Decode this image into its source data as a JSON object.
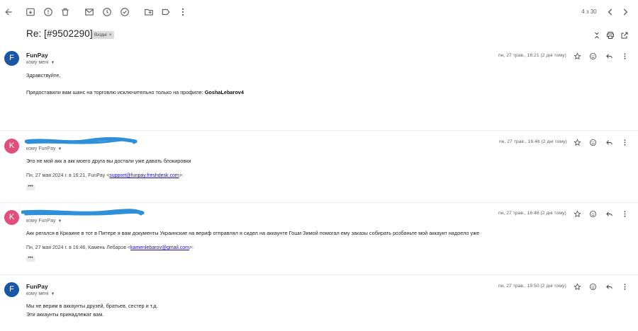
{
  "toolbar": {
    "pager": "4 з 30"
  },
  "thread": {
    "subject": "Re: [#9502290]",
    "label": "Вхідні",
    "label_close": "×"
  },
  "messages": [
    {
      "avatar_letter": "F",
      "avatar_color": "#1a56a6",
      "sender": "FunPay",
      "recipient": "кому мені",
      "date": "пн, 27 трав., 16:21 (2 дні тому)",
      "body": [
        "Здравствуйте,"
      ],
      "body_prefix": "Предоставили вам шанс на торговлю исключительно только на профиле: ",
      "body_bold": "GoshaLebarov4"
    },
    {
      "avatar_letter": "K",
      "avatar_color": "#e0507a",
      "recipient": "кому FunPay",
      "date": "пн, 27 трав., 16:46 (2 дні тому)",
      "body": [
        "Это не мой акк а акк моего друга вы достали уже давать блокировки"
      ],
      "quote_prefix": "Пн, 27 мая 2024 г. в 16:21, FunPay <",
      "quote_link": "support@funpay.freshdesk.com",
      "quote_suffix": ">:",
      "dots": "•••"
    },
    {
      "avatar_letter": "K",
      "avatar_color": "#e0507a",
      "recipient": "кому FunPay",
      "date": "пн, 27 трав., 16:48 (2 дні тому)",
      "body": [
        "Акк регался в Кркаине в тот в Питере я вам документы Украинские на вериф отправлял я сидел на аккаунте Гоши Зимой помогал ему заказы собирать розбаньте мой аккаунт надоело уже"
      ],
      "quote_prefix": "Пн, 27 мая 2024 г. в 16:46, Камень Лебаров <",
      "quote_link": "kamenlebarov@gmail.com",
      "quote_suffix": ">:",
      "dots": "•••"
    },
    {
      "avatar_letter": "F",
      "avatar_color": "#1a56a6",
      "sender": "FunPay",
      "recipient": "кому мені",
      "date": "пн, 27 трав., 19:50 (2 дні тому)",
      "body": [
        "Мы не верим в аккаунты друзей, братьев, сестер и т.д.",
        "Эти аккаунты принадлежат вам."
      ]
    }
  ],
  "colors": {
    "accent_blue": "#1a56a6",
    "avatar_pink": "#e0507a",
    "scribble_blue": "#2f8fd8"
  }
}
